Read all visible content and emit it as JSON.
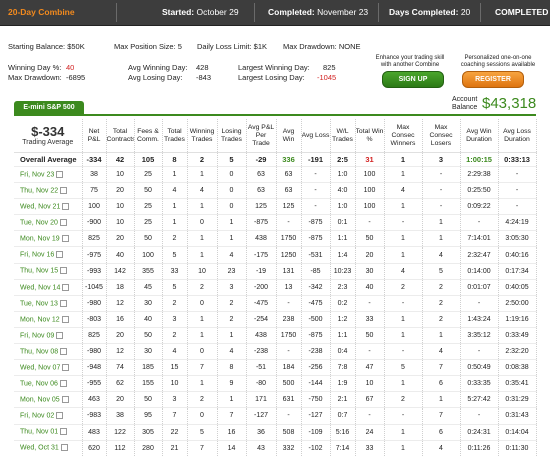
{
  "header": {
    "title": "20-Day Combine",
    "started_label": "Started:",
    "started_value": "October 29",
    "completed_label": "Completed:",
    "completed_value": "November 23",
    "days_label": "Days Completed:",
    "days_value": "20",
    "status": "COMPLETED"
  },
  "summary": {
    "starting_balance": "Starting Balance: $50K",
    "max_position": "Max Position Size: 5",
    "daily_loss": "Daily Loss Limit: $1K",
    "max_drawdown_limit": "Max Drawdown: NONE",
    "winning_day_pct_label": "Winning Day %:",
    "winning_day_pct": "40",
    "max_drawdown_label": "Max Drawdown:",
    "max_drawdown": "-6895",
    "avg_win_day_label": "Avg Winning Day:",
    "avg_win_day": "428",
    "avg_los_day_label": "Avg Losing Day:",
    "avg_los_day": "-843",
    "largest_win_label": "Largest Winning Day:",
    "largest_win": "825",
    "largest_loss_label": "Largest Losing Day:",
    "largest_loss": "-1045"
  },
  "promo": {
    "left_text_1": "Enhance your trading skill",
    "left_text_2": "with another Combine",
    "signup": "SIGN UP",
    "right_text_1": "Personalized one-on-one",
    "right_text_2": "coaching sessions available",
    "register": "REGISTER"
  },
  "account": {
    "tab": "E-mini S&P 500",
    "balance_label_1": "Account",
    "balance_label_2": "Balance",
    "balance": "$43,318"
  },
  "table": {
    "total_pl": "$-334",
    "total_pl_sub": "Trading Average",
    "headers": [
      "Net P&L",
      "Total Contracts",
      "Fees & Comm.",
      "Total Trades",
      "Winning Trades",
      "Losing Trades",
      "Avg P&L Per Trade",
      "Avg Win",
      "Avg Loss",
      "W/L Trades",
      "Total Win %",
      "Max Consec Winners",
      "Max Consec Losers",
      "Avg Win Duration",
      "Avg Loss Duration"
    ],
    "average": {
      "label": "Overall Average",
      "cells": [
        "-334",
        "42",
        "105",
        "8",
        "2",
        "5",
        "-29",
        "336",
        "-191",
        "2:5",
        "31",
        "1",
        "3",
        "1:00:15",
        "0:33:13"
      ]
    },
    "rows": [
      {
        "date": "Fri, Nov 23",
        "cells": [
          "38",
          "10",
          "25",
          "1",
          "1",
          "0",
          "63",
          "63",
          "-",
          "1:0",
          "100",
          "1",
          "-",
          "2:29:38",
          "-"
        ]
      },
      {
        "date": "Thu, Nov 22",
        "cells": [
          "75",
          "20",
          "50",
          "4",
          "4",
          "0",
          "63",
          "63",
          "-",
          "4:0",
          "100",
          "4",
          "-",
          "0:25:50",
          "-"
        ]
      },
      {
        "date": "Wed, Nov 21",
        "cells": [
          "100",
          "10",
          "25",
          "1",
          "1",
          "0",
          "125",
          "125",
          "-",
          "1:0",
          "100",
          "1",
          "-",
          "0:09:22",
          "-"
        ]
      },
      {
        "date": "Tue, Nov 20",
        "cells": [
          "-900",
          "10",
          "25",
          "1",
          "0",
          "1",
          "-875",
          "-",
          "-875",
          "0:1",
          "-",
          "-",
          "1",
          "-",
          "4:24:19"
        ]
      },
      {
        "date": "Mon, Nov 19",
        "cells": [
          "825",
          "20",
          "50",
          "2",
          "1",
          "1",
          "438",
          "1750",
          "-875",
          "1:1",
          "50",
          "1",
          "1",
          "7:14:01",
          "3:05:30"
        ]
      },
      {
        "date": "Fri, Nov 16",
        "cells": [
          "-975",
          "40",
          "100",
          "5",
          "1",
          "4",
          "-175",
          "1250",
          "-531",
          "1:4",
          "20",
          "1",
          "4",
          "2:32:47",
          "0:40:16"
        ]
      },
      {
        "date": "Thu, Nov 15",
        "cells": [
          "-993",
          "142",
          "355",
          "33",
          "10",
          "23",
          "-19",
          "131",
          "-85",
          "10:23",
          "30",
          "4",
          "5",
          "0:14:00",
          "0:17:34"
        ]
      },
      {
        "date": "Wed, Nov 14",
        "cells": [
          "-1045",
          "18",
          "45",
          "5",
          "2",
          "3",
          "-200",
          "13",
          "-342",
          "2:3",
          "40",
          "2",
          "2",
          "0:01:07",
          "0:40:05"
        ]
      },
      {
        "date": "Tue, Nov 13",
        "cells": [
          "-980",
          "12",
          "30",
          "2",
          "0",
          "2",
          "-475",
          "-",
          "-475",
          "0:2",
          "-",
          "-",
          "2",
          "-",
          "2:50:00"
        ]
      },
      {
        "date": "Mon, Nov 12",
        "cells": [
          "-803",
          "16",
          "40",
          "3",
          "1",
          "2",
          "-254",
          "238",
          "-500",
          "1:2",
          "33",
          "1",
          "2",
          "1:43:24",
          "1:19:16"
        ]
      },
      {
        "date": "Fri, Nov 09",
        "cells": [
          "825",
          "20",
          "50",
          "2",
          "1",
          "1",
          "438",
          "1750",
          "-875",
          "1:1",
          "50",
          "1",
          "1",
          "3:35:12",
          "0:33:49"
        ]
      },
      {
        "date": "Thu, Nov 08",
        "cells": [
          "-980",
          "12",
          "30",
          "4",
          "0",
          "4",
          "-238",
          "-",
          "-238",
          "0:4",
          "-",
          "-",
          "4",
          "-",
          "2:32:20"
        ]
      },
      {
        "date": "Wed, Nov 07",
        "cells": [
          "-948",
          "74",
          "185",
          "15",
          "7",
          "8",
          "-51",
          "184",
          "-256",
          "7:8",
          "47",
          "5",
          "7",
          "0:50:49",
          "0:08:38"
        ]
      },
      {
        "date": "Tue, Nov 06",
        "cells": [
          "-955",
          "62",
          "155",
          "10",
          "1",
          "9",
          "-80",
          "500",
          "-144",
          "1:9",
          "10",
          "1",
          "6",
          "0:33:35",
          "0:35:41"
        ]
      },
      {
        "date": "Mon, Nov 05",
        "cells": [
          "463",
          "20",
          "50",
          "3",
          "2",
          "1",
          "171",
          "631",
          "-750",
          "2:1",
          "67",
          "2",
          "1",
          "5:27:42",
          "0:31:29"
        ]
      },
      {
        "date": "Fri, Nov 02",
        "cells": [
          "-983",
          "38",
          "95",
          "7",
          "0",
          "7",
          "-127",
          "-",
          "-127",
          "0:7",
          "-",
          "-",
          "7",
          "-",
          "0:31:43"
        ]
      },
      {
        "date": "Thu, Nov 01",
        "cells": [
          "483",
          "122",
          "305",
          "22",
          "5",
          "16",
          "36",
          "508",
          "-109",
          "5:16",
          "24",
          "1",
          "6",
          "0:24:31",
          "0:14:04"
        ]
      },
      {
        "date": "Wed, Oct 31",
        "cells": [
          "620",
          "112",
          "280",
          "21",
          "7",
          "14",
          "43",
          "332",
          "-102",
          "7:14",
          "33",
          "1",
          "4",
          "0:11:26",
          "0:11:30"
        ]
      }
    ]
  },
  "colors": {
    "header_bg": "#3d3d3d",
    "accent_orange": "#f28a1e",
    "accent_green": "#3c8a1e",
    "negative_red": "#d22222"
  }
}
